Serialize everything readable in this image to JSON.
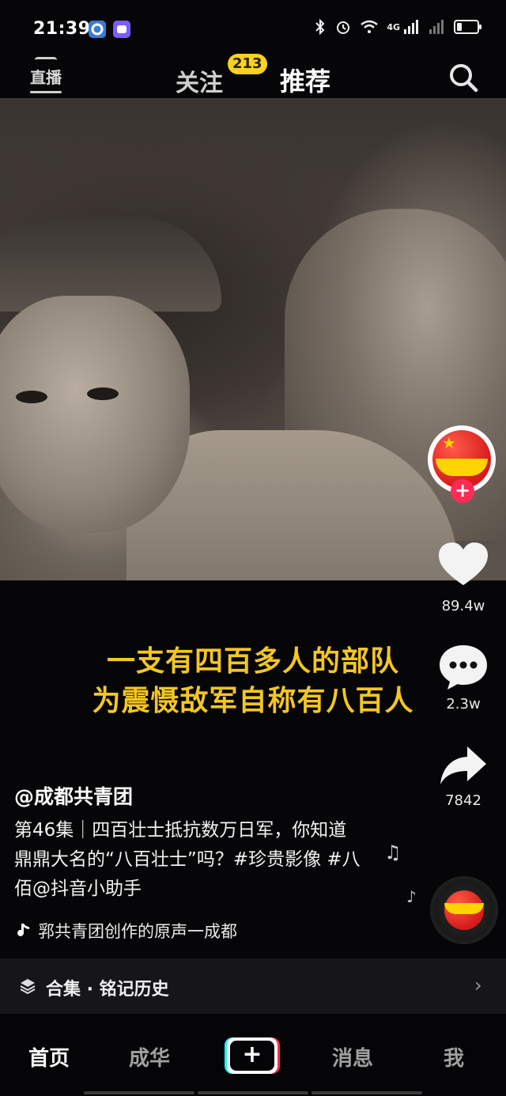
{
  "status": {
    "time": "21:39",
    "network": "4G",
    "icons": [
      "bluetooth-icon",
      "alarm-icon",
      "wifi-icon",
      "signal-icon",
      "battery-icon"
    ]
  },
  "topnav": {
    "live": "直播",
    "follow": "关注",
    "follow_badge": "213",
    "recommend": "推荐"
  },
  "caption": {
    "line1": "一支有四百多人的部队",
    "line2": "为震慑敌军自称有八百人"
  },
  "rail": {
    "likes": "89.4w",
    "comments": "2.3w",
    "shares": "7842"
  },
  "post": {
    "author": "@成都共青团",
    "description": "第46集｜四百壮士抵抗数万日军，你知道鼎鼎大名的“八百壮士”吗？#珍贵影像 #八佰@抖音小助手",
    "music": "郛共青团创作的原声一成都"
  },
  "collection": {
    "label": "合集 · 铭记历史"
  },
  "tabs": {
    "home": "首页",
    "chenghua": "成华",
    "messages": "消息",
    "me": "我"
  },
  "colors": {
    "accent_yellow": "#f3c623",
    "badge_yellow": "#ffd21e",
    "like_red": "#fe2c55",
    "cyan": "#25f4ee"
  }
}
